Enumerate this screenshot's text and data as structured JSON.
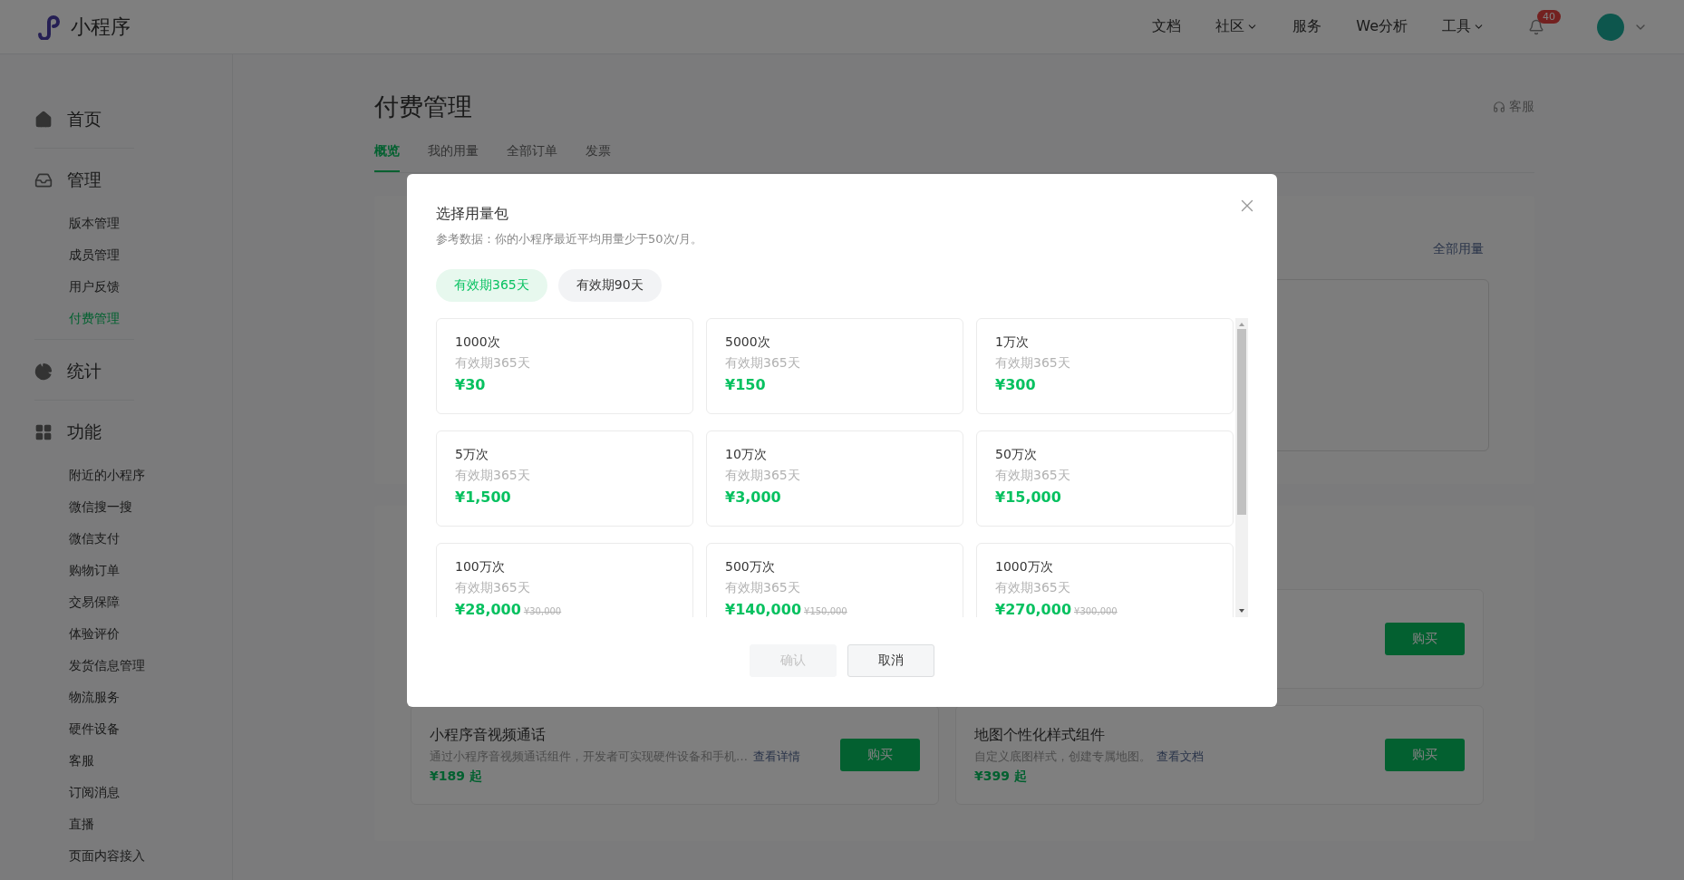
{
  "header": {
    "logo_text": "小程序",
    "nav": [
      {
        "label": "文档",
        "dropdown": false
      },
      {
        "label": "社区",
        "dropdown": true
      },
      {
        "label": "服务",
        "dropdown": false
      },
      {
        "label": "We分析",
        "dropdown": false
      },
      {
        "label": "工具",
        "dropdown": true
      }
    ],
    "notification_count": "40"
  },
  "sidebar": {
    "sections": [
      {
        "title": "首页"
      },
      {
        "title": "管理",
        "items": [
          {
            "label": "版本管理",
            "selected": false
          },
          {
            "label": "成员管理",
            "selected": false
          },
          {
            "label": "用户反馈",
            "selected": false
          },
          {
            "label": "付费管理",
            "selected": true
          }
        ]
      },
      {
        "title": "统计"
      },
      {
        "title": "功能",
        "items": [
          {
            "label": "附近的小程序",
            "selected": false
          },
          {
            "label": "微信搜一搜",
            "selected": false
          },
          {
            "label": "微信支付",
            "selected": false
          },
          {
            "label": "购物订单",
            "selected": false
          },
          {
            "label": "交易保障",
            "selected": false
          },
          {
            "label": "体验评价",
            "selected": false
          },
          {
            "label": "发货信息管理",
            "selected": false
          },
          {
            "label": "物流服务",
            "selected": false
          },
          {
            "label": "硬件设备",
            "selected": false
          },
          {
            "label": "客服",
            "selected": false
          },
          {
            "label": "订阅消息",
            "selected": false
          },
          {
            "label": "直播",
            "selected": false
          },
          {
            "label": "页面内容接入",
            "selected": false
          }
        ]
      }
    ]
  },
  "page": {
    "title": "付费管理",
    "service_link": "客服",
    "tabs": [
      {
        "label": "概览",
        "selected": true
      },
      {
        "label": "我的用量",
        "selected": false
      },
      {
        "label": "全部订单",
        "selected": false
      },
      {
        "label": "发票",
        "selected": false
      }
    ],
    "usage_link": "全部用量",
    "products": [
      {
        "kind": "covered",
        "button": "购买"
      },
      {
        "kind": "full",
        "title": "小程序音视频通话",
        "desc": "通过小程序音视频通话组件，开发者可实现硬件设备和手机…",
        "link": "查看详情",
        "price": "¥189 起",
        "button": "购买"
      },
      {
        "kind": "full",
        "title": "地图个性化样式组件",
        "desc": "自定义底图样式，创建专属地图。",
        "link": "查看文档",
        "price": "¥399 起",
        "button": "购买"
      }
    ]
  },
  "dialog": {
    "title": "选择用量包",
    "note": "参考数据：你的小程序最近平均用量少于50次/月。",
    "periods": [
      {
        "label": "有效期365天",
        "selected": true
      },
      {
        "label": "有效期90天",
        "selected": false
      }
    ],
    "packages": [
      {
        "count": "1000次",
        "validity": "有效期365天",
        "price": "¥30"
      },
      {
        "count": "5000次",
        "validity": "有效期365天",
        "price": "¥150"
      },
      {
        "count": "1万次",
        "validity": "有效期365天",
        "price": "¥300"
      },
      {
        "count": "5万次",
        "validity": "有效期365天",
        "price": "¥1,500"
      },
      {
        "count": "10万次",
        "validity": "有效期365天",
        "price": "¥3,000"
      },
      {
        "count": "50万次",
        "validity": "有效期365天",
        "price": "¥15,000"
      },
      {
        "count": "100万次",
        "validity": "有效期365天",
        "price": "¥28,000",
        "original_price": "¥30,000"
      },
      {
        "count": "500万次",
        "validity": "有效期365天",
        "price": "¥140,000",
        "original_price": "¥150,000"
      },
      {
        "count": "1000万次",
        "validity": "有效期365天",
        "price": "¥270,000",
        "original_price": "¥300,000"
      }
    ],
    "confirm": {
      "label": "确认",
      "disabled": true
    },
    "cancel": {
      "label": "取消"
    }
  }
}
